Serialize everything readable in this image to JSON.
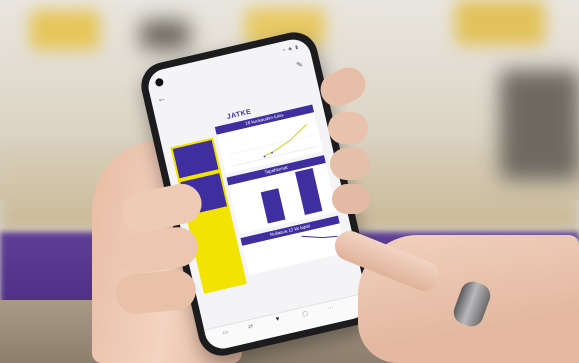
{
  "report": {
    "logo_text": "JATKE",
    "panels": [
      {
        "title": "18 kuukauden tulos"
      },
      {
        "title": "Tapahtumat"
      },
      {
        "title": "Rullaava 12 kk tapat"
      }
    ]
  },
  "icons": {
    "back": "back-arrow-icon",
    "edit": "pencil-icon",
    "nav_active": "triangle-down-icon"
  },
  "colors": {
    "brand_purple": "#3f2ea0",
    "brand_yellow": "#f2e300",
    "background_purple": "#5e3f96"
  }
}
